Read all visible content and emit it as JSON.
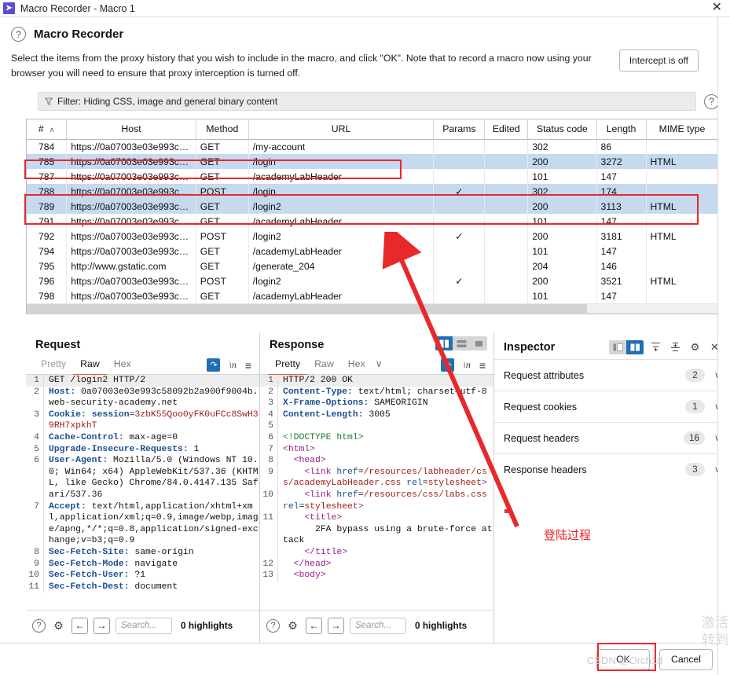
{
  "window": {
    "title": "Macro Recorder - Macro 1",
    "icon": "burp-logo-icon",
    "close_label": "✕"
  },
  "header": {
    "help_icon": "?",
    "title": "Macro Recorder",
    "description": "Select the items from the proxy history that you wish to include in the macro, and click \"OK\". Note that to record a macro now using your browser you will need to ensure that proxy interception is turned off.",
    "intercept_button": "Intercept is off"
  },
  "filter": {
    "text": "Filter: Hiding CSS, image and general binary content",
    "help_icon": "?"
  },
  "table": {
    "columns": [
      "#",
      "Host",
      "Method",
      "URL",
      "Params",
      "Edited",
      "Status code",
      "Length",
      "MIME type"
    ],
    "sort_indicator": "∧",
    "rows": [
      {
        "num": "784",
        "host": "https://0a07003e03e993c58092",
        "method": "GET",
        "url": "/my-account",
        "params": "",
        "edited": "",
        "status": "302",
        "length": "86",
        "mime": "",
        "selected": false
      },
      {
        "num": "785",
        "host": "https://0a07003e03e993c58092...",
        "method": "GET",
        "url": "/login",
        "params": "",
        "edited": "",
        "status": "200",
        "length": "3272",
        "mime": "HTML",
        "selected": true
      },
      {
        "num": "787",
        "host": "https://0a07003e03e993c58092...",
        "method": "GET",
        "url": "/academyLabHeader",
        "params": "",
        "edited": "",
        "status": "101",
        "length": "147",
        "mime": "",
        "selected": false
      },
      {
        "num": "788",
        "host": "https://0a07003e03e993c58092...",
        "method": "POST",
        "url": "/login",
        "params": "✓",
        "edited": "",
        "status": "302",
        "length": "174",
        "mime": "",
        "selected": true
      },
      {
        "num": "789",
        "host": "https://0a07003e03e993c58092...",
        "method": "GET",
        "url": "/login2",
        "params": "",
        "edited": "",
        "status": "200",
        "length": "3113",
        "mime": "HTML",
        "selected": true
      },
      {
        "num": "791",
        "host": "https://0a07003e03e993c58092...",
        "method": "GET",
        "url": "/academyLabHeader",
        "params": "",
        "edited": "",
        "status": "101",
        "length": "147",
        "mime": "",
        "selected": false
      },
      {
        "num": "792",
        "host": "https://0a07003e03e993c58092...",
        "method": "POST",
        "url": "/login2",
        "params": "✓",
        "edited": "",
        "status": "200",
        "length": "3181",
        "mime": "HTML",
        "selected": false
      },
      {
        "num": "794",
        "host": "https://0a07003e03e993c58092...",
        "method": "GET",
        "url": "/academyLabHeader",
        "params": "",
        "edited": "",
        "status": "101",
        "length": "147",
        "mime": "",
        "selected": false
      },
      {
        "num": "795",
        "host": "http://www.gstatic.com",
        "method": "GET",
        "url": "/generate_204",
        "params": "",
        "edited": "",
        "status": "204",
        "length": "146",
        "mime": "",
        "selected": false
      },
      {
        "num": "796",
        "host": "https://0a07003e03e993c58092...",
        "method": "POST",
        "url": "/login2",
        "params": "✓",
        "edited": "",
        "status": "200",
        "length": "3521",
        "mime": "HTML",
        "selected": false
      },
      {
        "num": "798",
        "host": "https://0a07003e03e993c58092...",
        "method": "GET",
        "url": "/academyLabHeader",
        "params": "",
        "edited": "",
        "status": "101",
        "length": "147",
        "mime": "",
        "selected": false
      }
    ]
  },
  "request": {
    "title": "Request",
    "tabs": [
      {
        "label": "Pretty",
        "active": false,
        "disabled": true
      },
      {
        "label": "Raw",
        "active": true,
        "disabled": false
      },
      {
        "label": "Hex",
        "active": false,
        "disabled": false
      }
    ],
    "wrap_icon": "word-wrap-icon",
    "newline_icon": "\\n",
    "menu_icon": "≡",
    "lines": [
      {
        "n": "1",
        "html": "<span class=\"v\">GET /login2 HTTP/2</span>",
        "hl": true
      },
      {
        "n": "2",
        "html": "<span class=\"k\">Host:</span><span class=\"v\"> 0a07003e03e993c58092b2a900f9004b.web-security-academy.net</span>",
        "hl": false
      },
      {
        "n": "3",
        "html": "<span class=\"k\">Cookie:</span> <span class=\"k\">session</span><span class=\"v\">=</span><span class=\"red\">3zbK55Qoo0yFK0uFCc8SwH39RH7xpkhT</span>",
        "hl": false
      },
      {
        "n": "4",
        "html": "<span class=\"k\">Cache-Control:</span><span class=\"v\"> max-age=0</span>",
        "hl": false
      },
      {
        "n": "5",
        "html": "<span class=\"k\">Upgrade-Insecure-Requests:</span><span class=\"v\"> 1</span>",
        "hl": false
      },
      {
        "n": "6",
        "html": "<span class=\"k\">User-Agent:</span><span class=\"v\"> Mozilla/5.0 (Windows NT 10.0; Win64; x64) AppleWebKit/537.36 (KHTML, like Gecko) Chrome/84.0.4147.135 Safari/537.36</span>",
        "hl": false
      },
      {
        "n": "7",
        "html": "<span class=\"k\">Accept:</span><span class=\"v\"> text/html,application/xhtml+xml,application/xml;q=0.9,image/webp,image/apng,*/*;q=0.8,application/signed-exchange;v=b3;q=0.9</span>",
        "hl": false
      },
      {
        "n": "8",
        "html": "<span class=\"k\">Sec-Fetch-Site:</span><span class=\"v\"> same-origin</span>",
        "hl": false
      },
      {
        "n": "9",
        "html": "<span class=\"k\">Sec-Fetch-Mode:</span><span class=\"v\"> navigate</span>",
        "hl": false
      },
      {
        "n": "10",
        "html": "<span class=\"k\">Sec-Fetch-User:</span><span class=\"v\"> ?1</span>",
        "hl": false
      },
      {
        "n": "11",
        "html": "<span class=\"k\">Sec-Fetch-Dest:</span><span class=\"v\"> document</span>",
        "hl": false
      }
    ],
    "footer": {
      "help_icon": "?",
      "settings_icon": "gear-icon",
      "back_icon": "←",
      "forward_icon": "→",
      "search_placeholder": "Search...",
      "highlights": "0 highlights"
    }
  },
  "response": {
    "title": "Response",
    "tabs": [
      {
        "label": "Pretty",
        "active": true,
        "disabled": false
      },
      {
        "label": "Raw",
        "active": false,
        "disabled": false
      },
      {
        "label": "Hex",
        "active": false,
        "disabled": false
      }
    ],
    "more_icon": "∨",
    "wrap_icon": "word-wrap-icon",
    "newline_icon": "\\n",
    "menu_icon": "≡",
    "layout_buttons": [
      "split-vertical-icon",
      "split-horizontal-icon",
      "single-pane-icon"
    ],
    "lines": [
      {
        "n": "1",
        "html": "<span class=\"v\">HTTP/2 200 OK</span>",
        "hl": true
      },
      {
        "n": "2",
        "html": "<span class=\"k\">Content-Type:</span><span class=\"v\"> text/html; charset=utf-8</span>",
        "hl": false
      },
      {
        "n": "3",
        "html": "<span class=\"k\">X-Frame-Options:</span><span class=\"v\"> SAMEORIGIN</span>",
        "hl": false
      },
      {
        "n": "4",
        "html": "<span class=\"k\">Content-Length:</span><span class=\"v\"> 3005</span>",
        "hl": false
      },
      {
        "n": "5",
        "html": "&nbsp;",
        "hl": false
      },
      {
        "n": "6",
        "html": "<span class=\"grn\">&lt;!DOCTYPE html&gt;</span>",
        "hl": false
      },
      {
        "n": "7",
        "html": "<span class=\"tag\">&lt;html&gt;</span>",
        "hl": false
      },
      {
        "n": "8",
        "html": "  <span class=\"tag\">&lt;head&gt;</span>",
        "hl": false
      },
      {
        "n": "9",
        "html": "    <span class=\"tag\">&lt;link</span> <span class=\"attr\">href</span><span class=\"v\">=</span><span class=\"str\">/resources/labheader/css/academyLabHeader.css</span> <span class=\"attr\">rel</span><span class=\"v\">=</span><span class=\"str\">stylesheet</span><span class=\"tag\">&gt;</span>",
        "hl": false
      },
      {
        "n": "10",
        "html": "    <span class=\"tag\">&lt;link</span> <span class=\"attr\">href</span><span class=\"v\">=</span><span class=\"str\">/resources/css/labs.css</span> <span class=\"attr\">rel</span><span class=\"v\">=</span><span class=\"str\">stylesheet</span><span class=\"tag\">&gt;</span>",
        "hl": false
      },
      {
        "n": "11",
        "html": "    <span class=\"tag\">&lt;title&gt;</span>\n      <span class=\"v\">2FA bypass using a brute-force attack</span>\n    <span class=\"tag\">&lt;/title&gt;</span>",
        "hl": false
      },
      {
        "n": "12",
        "html": "  <span class=\"tag\">&lt;/head&gt;</span>",
        "hl": false
      },
      {
        "n": "13",
        "html": "  <span class=\"tag\">&lt;body&gt;</span>",
        "hl": false
      }
    ],
    "footer": {
      "help_icon": "?",
      "settings_icon": "gear-icon",
      "back_icon": "←",
      "forward_icon": "→",
      "search_placeholder": "Search...",
      "highlights": "0 highlights"
    }
  },
  "inspector": {
    "title": "Inspector",
    "layout_toggle": [
      "pane-left-icon",
      "pane-right-icon"
    ],
    "expand_icon": "expand-all-icon",
    "collapse_icon": "collapse-all-icon",
    "settings_icon": "gear-icon",
    "close_icon": "✕",
    "sections": [
      {
        "label": "Request attributes",
        "count": "2"
      },
      {
        "label": "Request cookies",
        "count": "1"
      },
      {
        "label": "Request headers",
        "count": "16"
      },
      {
        "label": "Response headers",
        "count": "3"
      }
    ]
  },
  "actions": {
    "ok": "OK",
    "cancel": "Cancel"
  },
  "annotations": {
    "chinese_note": "登陆过程",
    "watermark": "CSDN @Orch1d",
    "windows_activation_line1": "激活",
    "windows_activation_line2": "转到",
    "accent_red": "#e8282a",
    "accent_blue": "#1f6fb4",
    "selection_blue": "#c5d9ef"
  }
}
